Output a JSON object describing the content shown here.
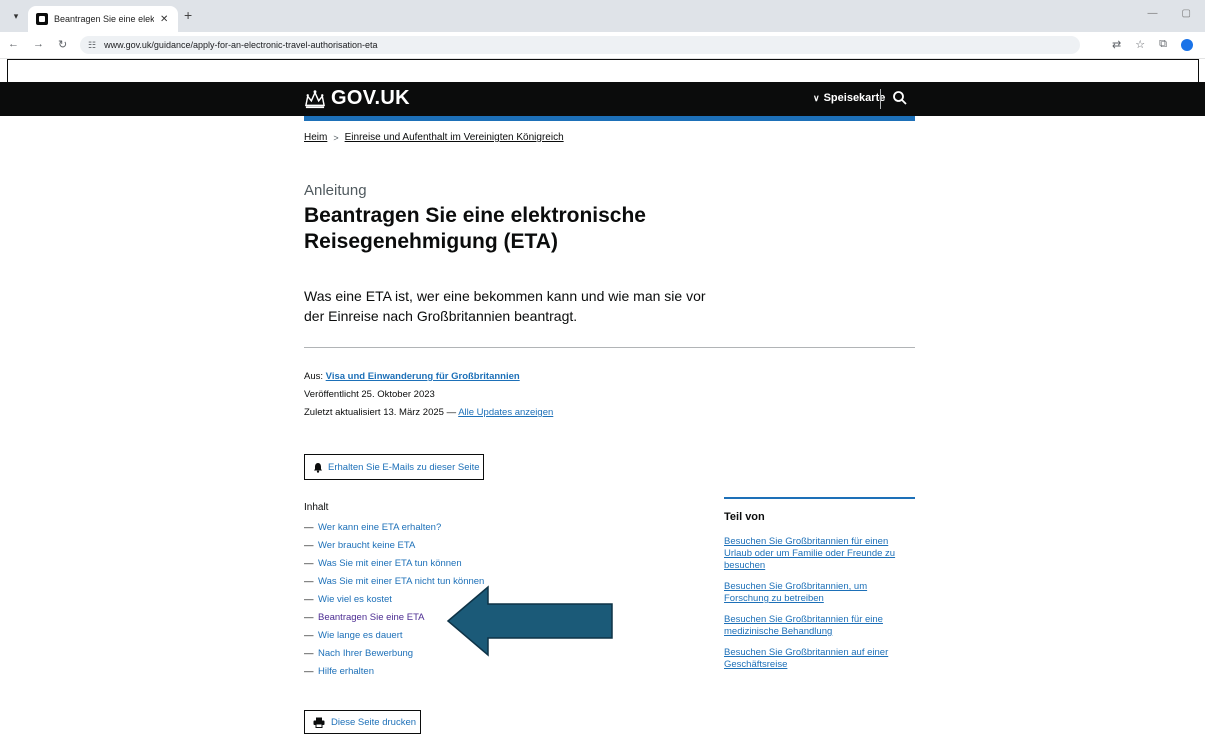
{
  "browser": {
    "tab_title": "Beantragen Sie eine elektronisc",
    "tab_close": "✕",
    "new_tab": "+",
    "url": "www.gov.uk/guidance/apply-for-an-electronic-travel-authorisation-eta"
  },
  "header": {
    "logo_text": "GOV.UK",
    "menu_label": "Speisekarte"
  },
  "breadcrumb": {
    "items": [
      "Heim",
      "Einreise und Aufenthalt im Vereinigten Königreich"
    ],
    "separator": ">"
  },
  "page": {
    "caption": "Anleitung",
    "title": "Beantragen Sie eine elektronische Reisegenehmigung (ETA)",
    "lead": "Was eine ETA ist, wer eine bekommen kann und wie man sie vor der Einreise nach Großbritannien beantragt."
  },
  "meta": {
    "from_label": "Aus:",
    "from_link": "Visa und Einwanderung für Großbritannien",
    "published": "Veröffentlicht 25. Oktober 2023",
    "updated": "Zuletzt aktualisiert 13. März 2025 —",
    "updates_link": "Alle Updates anzeigen"
  },
  "email_button": "Erhalten Sie E-Mails zu dieser Seite",
  "contents": {
    "heading": "Inhalt",
    "dash": "—",
    "items": [
      "Wer kann eine ETA erhalten?",
      "Wer braucht keine ETA",
      "Was Sie mit einer ETA tun können",
      "Was Sie mit einer ETA nicht tun können",
      "Wie viel es kostet",
      "Beantragen Sie eine ETA",
      "Wie lange es dauert",
      "Nach Ihrer Bewerbung",
      "Hilfe erhalten"
    ]
  },
  "print_button": "Diese Seite drucken",
  "sidebar": {
    "heading": "Teil von",
    "links": [
      "Besuchen Sie Großbritannien für einen Urlaub oder um Familie oder Freunde zu besuchen",
      "Besuchen Sie Großbritannien, um Forschung zu betreiben",
      "Besuchen Sie Großbritannien für eine medizinische Behandlung",
      "Besuchen Sie Großbritannien auf einer Geschäftsreise"
    ]
  },
  "colors": {
    "link": "#1d70b8",
    "visited": "#4c2c92",
    "header_bg": "#0b0c0c",
    "arrow": "#1b5a78"
  }
}
